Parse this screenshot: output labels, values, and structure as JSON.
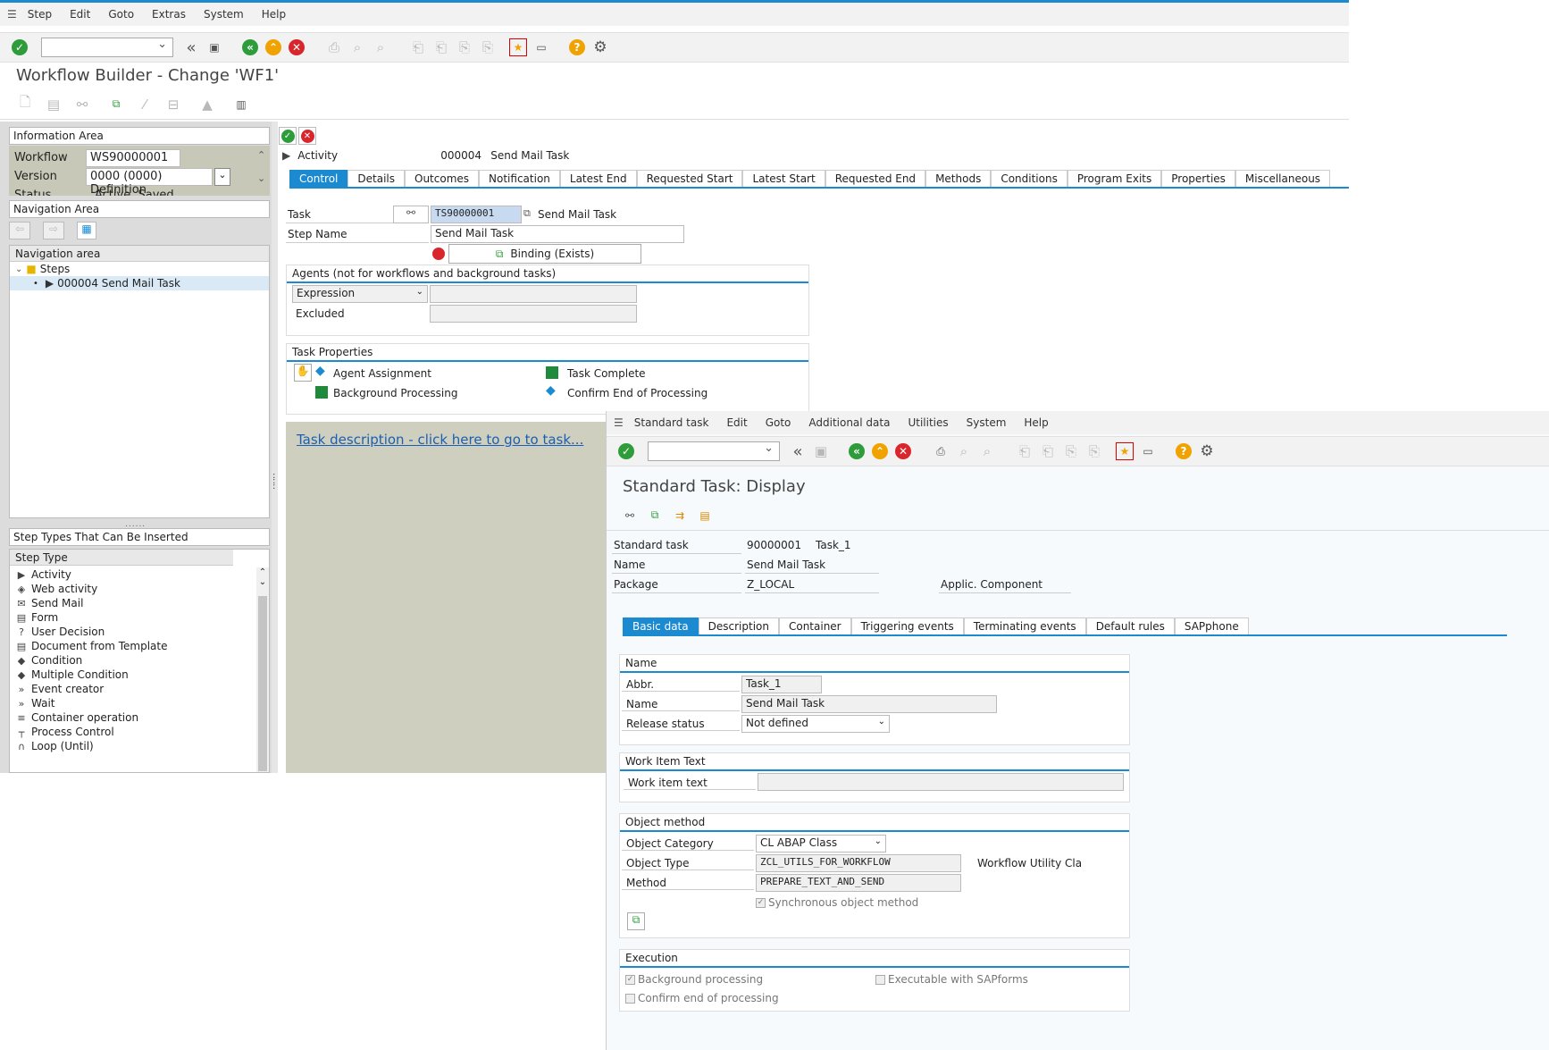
{
  "wb": {
    "menu": [
      "Step",
      "Edit",
      "Goto",
      "Extras",
      "System",
      "Help"
    ],
    "title": "Workflow Builder - Change 'WF1'",
    "info_area": {
      "header": "Information Area",
      "workflow_label": "Workflow",
      "workflow_value": "WS90000001",
      "version_label": "Version",
      "version_value": "0000 (0000) Definition",
      "status_label": "Status",
      "status_value": "Active, Saved"
    },
    "nav_area": {
      "header": "Navigation Area",
      "tree_header": "Navigation area",
      "root": "Steps",
      "item": "000004 Send Mail Task"
    },
    "step_types": {
      "header": "Step Types That Can Be Inserted",
      "col_header": "Step Type",
      "items": [
        {
          "label": "Activity",
          "icon": "▶"
        },
        {
          "label": "Web activity",
          "icon": "◈"
        },
        {
          "label": "Send Mail",
          "icon": "✉"
        },
        {
          "label": "Form",
          "icon": "▤"
        },
        {
          "label": "User Decision",
          "icon": "?"
        },
        {
          "label": "Document from Template",
          "icon": "▤"
        },
        {
          "label": "Condition",
          "icon": "◆"
        },
        {
          "label": "Multiple Condition",
          "icon": "◆"
        },
        {
          "label": "Event creator",
          "icon": "»"
        },
        {
          "label": "Wait",
          "icon": "»"
        },
        {
          "label": "Container operation",
          "icon": "≡"
        },
        {
          "label": "Process Control",
          "icon": "┬"
        },
        {
          "label": "Loop (Until)",
          "icon": "∩"
        }
      ]
    },
    "detail": {
      "type_label": "Activity",
      "step_no": "000004",
      "step_name": "Send Mail Task",
      "tabs": [
        "Control",
        "Details",
        "Outcomes",
        "Notification",
        "Latest End",
        "Requested Start",
        "Latest Start",
        "Requested End",
        "Methods",
        "Conditions",
        "Program Exits",
        "Properties",
        "Miscellaneous"
      ],
      "task_label": "Task",
      "task_value": "TS90000001",
      "task_desc": "Send Mail Task",
      "stepname_label": "Step Name",
      "stepname_value": "Send Mail Task",
      "binding_label": "Binding (Exists)",
      "agents_title": "Agents (not for workflows and background tasks)",
      "agents_expression": "Expression",
      "agents_excluded": "Excluded",
      "task_props_title": "Task Properties",
      "prop_agent_assignment": "Agent Assignment",
      "prop_task_complete": "Task Complete",
      "prop_background": "Background Processing",
      "prop_confirm": "Confirm End of Processing",
      "task_link": "Task description - click here to go to task..."
    }
  },
  "st": {
    "menu": [
      "Standard task",
      "Edit",
      "Goto",
      "Additional data",
      "Utilities",
      "System",
      "Help"
    ],
    "title": "Standard Task: Display",
    "std_task_label": "Standard task",
    "std_task_no": "90000001",
    "std_task_abbr": "Task_1",
    "name_label": "Name",
    "name_value": "Send Mail Task",
    "package_label": "Package",
    "package_value": "Z_LOCAL",
    "applcomp_label": "Applic. Component",
    "tabs": [
      "Basic data",
      "Description",
      "Container",
      "Triggering events",
      "Terminating events",
      "Default rules",
      "SAPphone"
    ],
    "name_group": {
      "title": "Name",
      "abbr_label": "Abbr.",
      "abbr_value": "Task_1",
      "name_label": "Name",
      "name_value": "Send Mail Task",
      "release_label": "Release status",
      "release_value": "Not defined"
    },
    "work_item": {
      "title": "Work Item Text",
      "label": "Work item text",
      "value": ""
    },
    "object_method": {
      "title": "Object method",
      "cat_label": "Object Category",
      "cat_value": "CL ABAP Class",
      "type_label": "Object Type",
      "type_value": "ZCL_UTILS_FOR_WORKFLOW",
      "type_desc": "Workflow Utility Cla",
      "method_label": "Method",
      "method_value": "PREPARE_TEXT_AND_SEND",
      "sync_label": "Synchronous object method"
    },
    "execution": {
      "title": "Execution",
      "bg_label": "Background processing",
      "sapforms_label": "Executable with SAPforms",
      "confirm_label": "Confirm end of processing"
    }
  }
}
